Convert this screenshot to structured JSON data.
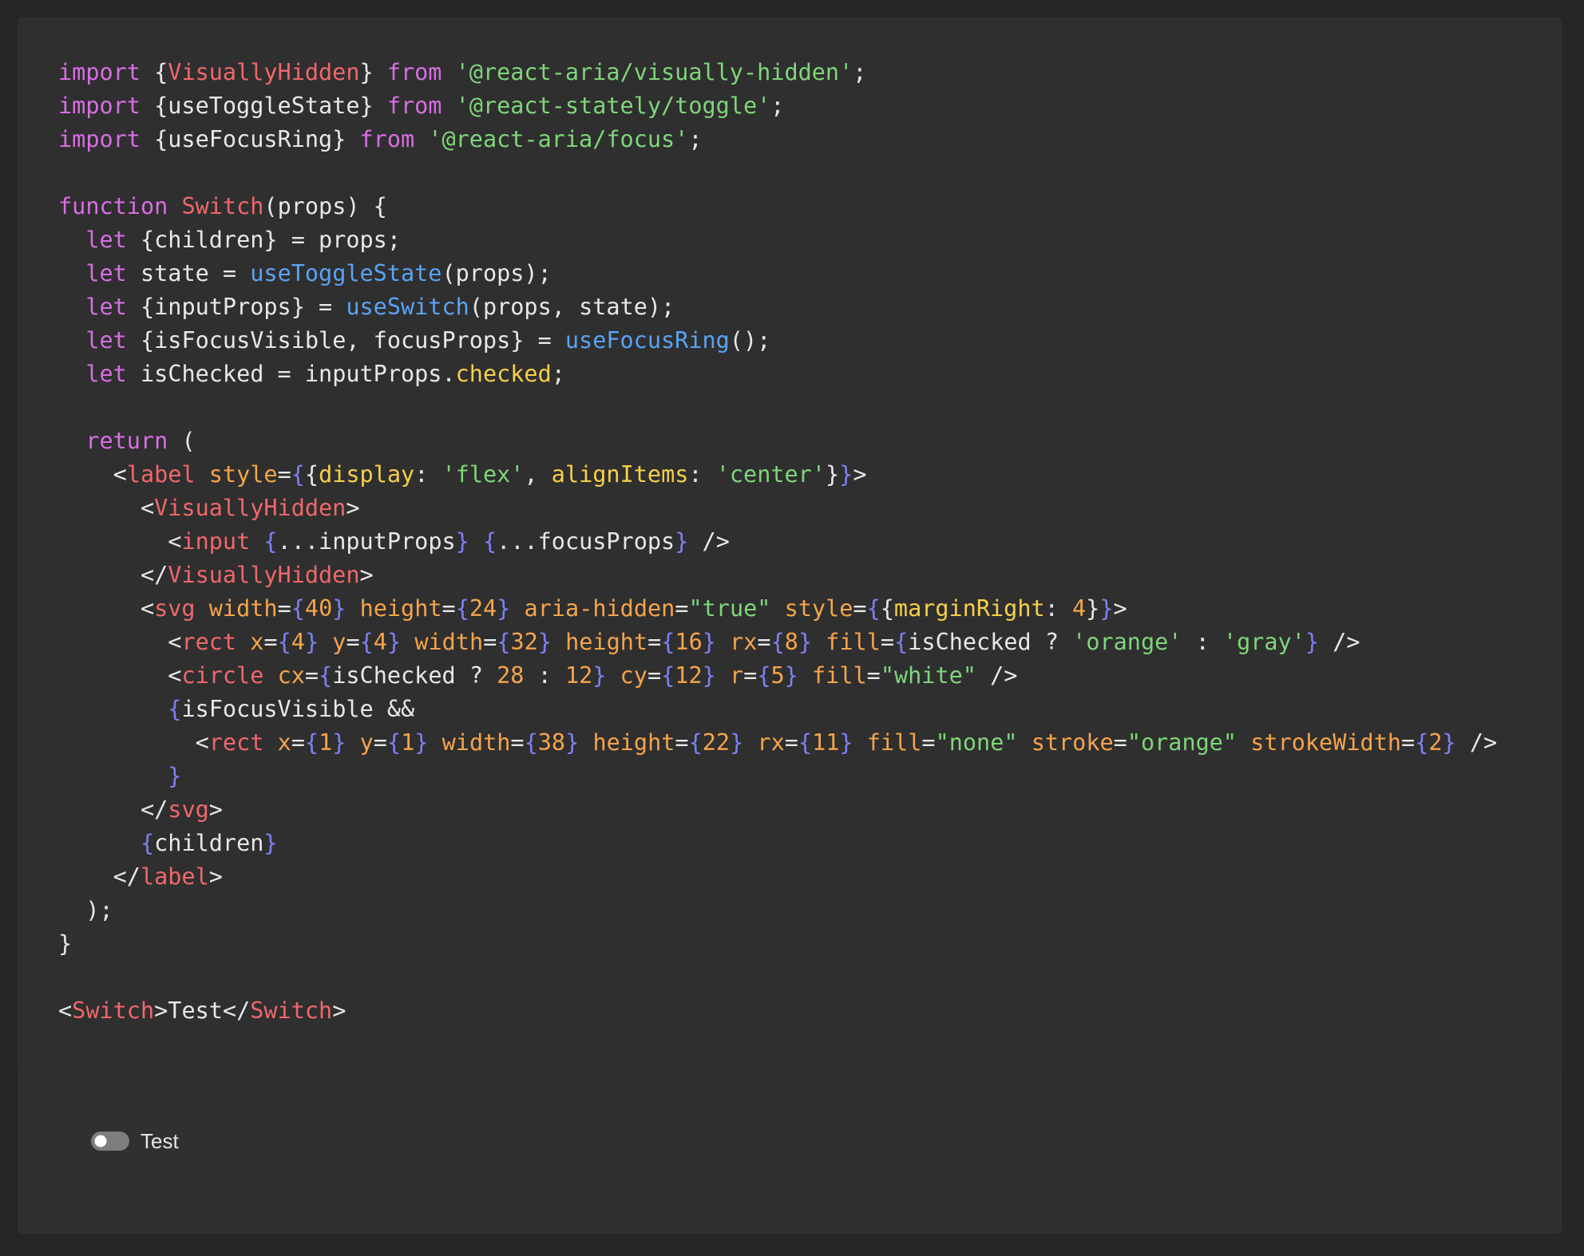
{
  "code": {
    "lines": [
      [
        [
          "kw",
          "import"
        ],
        [
          "pl",
          " {"
        ],
        [
          "cls",
          "VisuallyHidden"
        ],
        [
          "pl",
          "} "
        ],
        [
          "kw",
          "from"
        ],
        [
          "pl",
          " "
        ],
        [
          "str",
          "'@react-aria/visually-hidden'"
        ],
        [
          "pl",
          ";"
        ]
      ],
      [
        [
          "kw",
          "import"
        ],
        [
          "pl",
          " {useToggleState} "
        ],
        [
          "kw",
          "from"
        ],
        [
          "pl",
          " "
        ],
        [
          "str",
          "'@react-stately/toggle'"
        ],
        [
          "pl",
          ";"
        ]
      ],
      [
        [
          "kw",
          "import"
        ],
        [
          "pl",
          " {useFocusRing} "
        ],
        [
          "kw",
          "from"
        ],
        [
          "pl",
          " "
        ],
        [
          "str",
          "'@react-aria/focus'"
        ],
        [
          "pl",
          ";"
        ]
      ],
      [],
      [
        [
          "kw",
          "function"
        ],
        [
          "pl",
          " "
        ],
        [
          "cls",
          "Switch"
        ],
        [
          "pl",
          "(props) {"
        ]
      ],
      [
        [
          "pl",
          "  "
        ],
        [
          "kw",
          "let"
        ],
        [
          "pl",
          " {children} = props;"
        ]
      ],
      [
        [
          "pl",
          "  "
        ],
        [
          "kw",
          "let"
        ],
        [
          "pl",
          " state = "
        ],
        [
          "fn",
          "useToggleState"
        ],
        [
          "pl",
          "(props);"
        ]
      ],
      [
        [
          "pl",
          "  "
        ],
        [
          "kw",
          "let"
        ],
        [
          "pl",
          " {inputProps} = "
        ],
        [
          "fn",
          "useSwitch"
        ],
        [
          "pl",
          "(props, state);"
        ]
      ],
      [
        [
          "pl",
          "  "
        ],
        [
          "kw",
          "let"
        ],
        [
          "pl",
          " {isFocusVisible, focusProps} = "
        ],
        [
          "fn",
          "useFocusRing"
        ],
        [
          "pl",
          "();"
        ]
      ],
      [
        [
          "pl",
          "  "
        ],
        [
          "kw",
          "let"
        ],
        [
          "pl",
          " isChecked = inputProps."
        ],
        [
          "prop",
          "checked"
        ],
        [
          "pl",
          ";"
        ]
      ],
      [],
      [
        [
          "pl",
          "  "
        ],
        [
          "kw",
          "return"
        ],
        [
          "pl",
          " ("
        ]
      ],
      [
        [
          "pl",
          "    <"
        ],
        [
          "cls",
          "label"
        ],
        [
          "pl",
          " "
        ],
        [
          "attr",
          "style"
        ],
        [
          "pl",
          "="
        ],
        [
          "br",
          "{"
        ],
        [
          "pl",
          "{"
        ],
        [
          "prop",
          "display"
        ],
        [
          "pl",
          ": "
        ],
        [
          "str",
          "'flex'"
        ],
        [
          "pl",
          ", "
        ],
        [
          "prop",
          "alignItems"
        ],
        [
          "pl",
          ": "
        ],
        [
          "str",
          "'center'"
        ],
        [
          "pl",
          "}"
        ],
        [
          "br",
          "}"
        ],
        [
          "pl",
          ">"
        ]
      ],
      [
        [
          "pl",
          "      <"
        ],
        [
          "cls",
          "VisuallyHidden"
        ],
        [
          "pl",
          ">"
        ]
      ],
      [
        [
          "pl",
          "        <"
        ],
        [
          "cls",
          "input"
        ],
        [
          "pl",
          " "
        ],
        [
          "br",
          "{"
        ],
        [
          "pl",
          "...inputProps"
        ],
        [
          "br",
          "}"
        ],
        [
          "pl",
          " "
        ],
        [
          "br",
          "{"
        ],
        [
          "pl",
          "...focusProps"
        ],
        [
          "br",
          "}"
        ],
        [
          "pl",
          " />"
        ]
      ],
      [
        [
          "pl",
          "      </"
        ],
        [
          "cls",
          "VisuallyHidden"
        ],
        [
          "pl",
          ">"
        ]
      ],
      [
        [
          "pl",
          "      <"
        ],
        [
          "cls",
          "svg"
        ],
        [
          "pl",
          " "
        ],
        [
          "attr",
          "width"
        ],
        [
          "pl",
          "="
        ],
        [
          "br",
          "{"
        ],
        [
          "num",
          "40"
        ],
        [
          "br",
          "}"
        ],
        [
          "pl",
          " "
        ],
        [
          "attr",
          "height"
        ],
        [
          "pl",
          "="
        ],
        [
          "br",
          "{"
        ],
        [
          "num",
          "24"
        ],
        [
          "br",
          "}"
        ],
        [
          "pl",
          " "
        ],
        [
          "attr",
          "aria-hidden"
        ],
        [
          "pl",
          "="
        ],
        [
          "str",
          "\"true\""
        ],
        [
          "pl",
          " "
        ],
        [
          "attr",
          "style"
        ],
        [
          "pl",
          "="
        ],
        [
          "br",
          "{"
        ],
        [
          "pl",
          "{"
        ],
        [
          "prop",
          "marginRight"
        ],
        [
          "pl",
          ": "
        ],
        [
          "num",
          "4"
        ],
        [
          "pl",
          "}"
        ],
        [
          "br",
          "}"
        ],
        [
          "pl",
          ">"
        ]
      ],
      [
        [
          "pl",
          "        <"
        ],
        [
          "cls",
          "rect"
        ],
        [
          "pl",
          " "
        ],
        [
          "attr",
          "x"
        ],
        [
          "pl",
          "="
        ],
        [
          "br",
          "{"
        ],
        [
          "num",
          "4"
        ],
        [
          "br",
          "}"
        ],
        [
          "pl",
          " "
        ],
        [
          "attr",
          "y"
        ],
        [
          "pl",
          "="
        ],
        [
          "br",
          "{"
        ],
        [
          "num",
          "4"
        ],
        [
          "br",
          "}"
        ],
        [
          "pl",
          " "
        ],
        [
          "attr",
          "width"
        ],
        [
          "pl",
          "="
        ],
        [
          "br",
          "{"
        ],
        [
          "num",
          "32"
        ],
        [
          "br",
          "}"
        ],
        [
          "pl",
          " "
        ],
        [
          "attr",
          "height"
        ],
        [
          "pl",
          "="
        ],
        [
          "br",
          "{"
        ],
        [
          "num",
          "16"
        ],
        [
          "br",
          "}"
        ],
        [
          "pl",
          " "
        ],
        [
          "attr",
          "rx"
        ],
        [
          "pl",
          "="
        ],
        [
          "br",
          "{"
        ],
        [
          "num",
          "8"
        ],
        [
          "br",
          "}"
        ],
        [
          "pl",
          " "
        ],
        [
          "attr",
          "fill"
        ],
        [
          "pl",
          "="
        ],
        [
          "br",
          "{"
        ],
        [
          "pl",
          "isChecked ? "
        ],
        [
          "str",
          "'orange'"
        ],
        [
          "pl",
          " : "
        ],
        [
          "str",
          "'gray'"
        ],
        [
          "br",
          "}"
        ],
        [
          "pl",
          " />"
        ]
      ],
      [
        [
          "pl",
          "        <"
        ],
        [
          "cls",
          "circle"
        ],
        [
          "pl",
          " "
        ],
        [
          "attr",
          "cx"
        ],
        [
          "pl",
          "="
        ],
        [
          "br",
          "{"
        ],
        [
          "pl",
          "isChecked ? "
        ],
        [
          "num",
          "28"
        ],
        [
          "pl",
          " : "
        ],
        [
          "num",
          "12"
        ],
        [
          "br",
          "}"
        ],
        [
          "pl",
          " "
        ],
        [
          "attr",
          "cy"
        ],
        [
          "pl",
          "="
        ],
        [
          "br",
          "{"
        ],
        [
          "num",
          "12"
        ],
        [
          "br",
          "}"
        ],
        [
          "pl",
          " "
        ],
        [
          "attr",
          "r"
        ],
        [
          "pl",
          "="
        ],
        [
          "br",
          "{"
        ],
        [
          "num",
          "5"
        ],
        [
          "br",
          "}"
        ],
        [
          "pl",
          " "
        ],
        [
          "attr",
          "fill"
        ],
        [
          "pl",
          "="
        ],
        [
          "str",
          "\"white\""
        ],
        [
          "pl",
          " />"
        ]
      ],
      [
        [
          "pl",
          "        "
        ],
        [
          "br",
          "{"
        ],
        [
          "pl",
          "isFocusVisible &&"
        ]
      ],
      [
        [
          "pl",
          "          <"
        ],
        [
          "cls",
          "rect"
        ],
        [
          "pl",
          " "
        ],
        [
          "attr",
          "x"
        ],
        [
          "pl",
          "="
        ],
        [
          "br",
          "{"
        ],
        [
          "num",
          "1"
        ],
        [
          "br",
          "}"
        ],
        [
          "pl",
          " "
        ],
        [
          "attr",
          "y"
        ],
        [
          "pl",
          "="
        ],
        [
          "br",
          "{"
        ],
        [
          "num",
          "1"
        ],
        [
          "br",
          "}"
        ],
        [
          "pl",
          " "
        ],
        [
          "attr",
          "width"
        ],
        [
          "pl",
          "="
        ],
        [
          "br",
          "{"
        ],
        [
          "num",
          "38"
        ],
        [
          "br",
          "}"
        ],
        [
          "pl",
          " "
        ],
        [
          "attr",
          "height"
        ],
        [
          "pl",
          "="
        ],
        [
          "br",
          "{"
        ],
        [
          "num",
          "22"
        ],
        [
          "br",
          "}"
        ],
        [
          "pl",
          " "
        ],
        [
          "attr",
          "rx"
        ],
        [
          "pl",
          "="
        ],
        [
          "br",
          "{"
        ],
        [
          "num",
          "11"
        ],
        [
          "br",
          "}"
        ],
        [
          "pl",
          " "
        ],
        [
          "attr",
          "fill"
        ],
        [
          "pl",
          "="
        ],
        [
          "str",
          "\"none\""
        ],
        [
          "pl",
          " "
        ],
        [
          "attr",
          "stroke"
        ],
        [
          "pl",
          "="
        ],
        [
          "str",
          "\"orange\""
        ],
        [
          "pl",
          " "
        ],
        [
          "attr",
          "strokeWidth"
        ],
        [
          "pl",
          "="
        ],
        [
          "br",
          "{"
        ],
        [
          "num",
          "2"
        ],
        [
          "br",
          "}"
        ],
        [
          "pl",
          " />"
        ]
      ],
      [
        [
          "pl",
          "        "
        ],
        [
          "br",
          "}"
        ]
      ],
      [
        [
          "pl",
          "      </"
        ],
        [
          "cls",
          "svg"
        ],
        [
          "pl",
          ">"
        ]
      ],
      [
        [
          "pl",
          "      "
        ],
        [
          "br",
          "{"
        ],
        [
          "pl",
          "children"
        ],
        [
          "br",
          "}"
        ]
      ],
      [
        [
          "pl",
          "    </"
        ],
        [
          "cls",
          "label"
        ],
        [
          "pl",
          ">"
        ]
      ],
      [
        [
          "pl",
          "  );"
        ]
      ],
      [
        [
          "pl",
          "}"
        ]
      ],
      [],
      [
        [
          "pl",
          "<"
        ],
        [
          "cls",
          "Switch"
        ],
        [
          "pl",
          ">Test</"
        ],
        [
          "cls",
          "Switch"
        ],
        [
          "pl",
          ">"
        ]
      ]
    ]
  },
  "preview": {
    "switch_label": "Test",
    "switch_checked": false,
    "track_color": "#7d7d7d",
    "thumb_color": "#ffffff"
  },
  "colors": {
    "page_bg": "#262626",
    "card_bg": "#303030",
    "keyword": "#d86ee4",
    "component": "#f0676b",
    "string": "#7fd67a",
    "function": "#5aa3f5",
    "attribute": "#f6a44b",
    "jsx_brace": "#7f7ff4",
    "property": "#f7d04a"
  }
}
